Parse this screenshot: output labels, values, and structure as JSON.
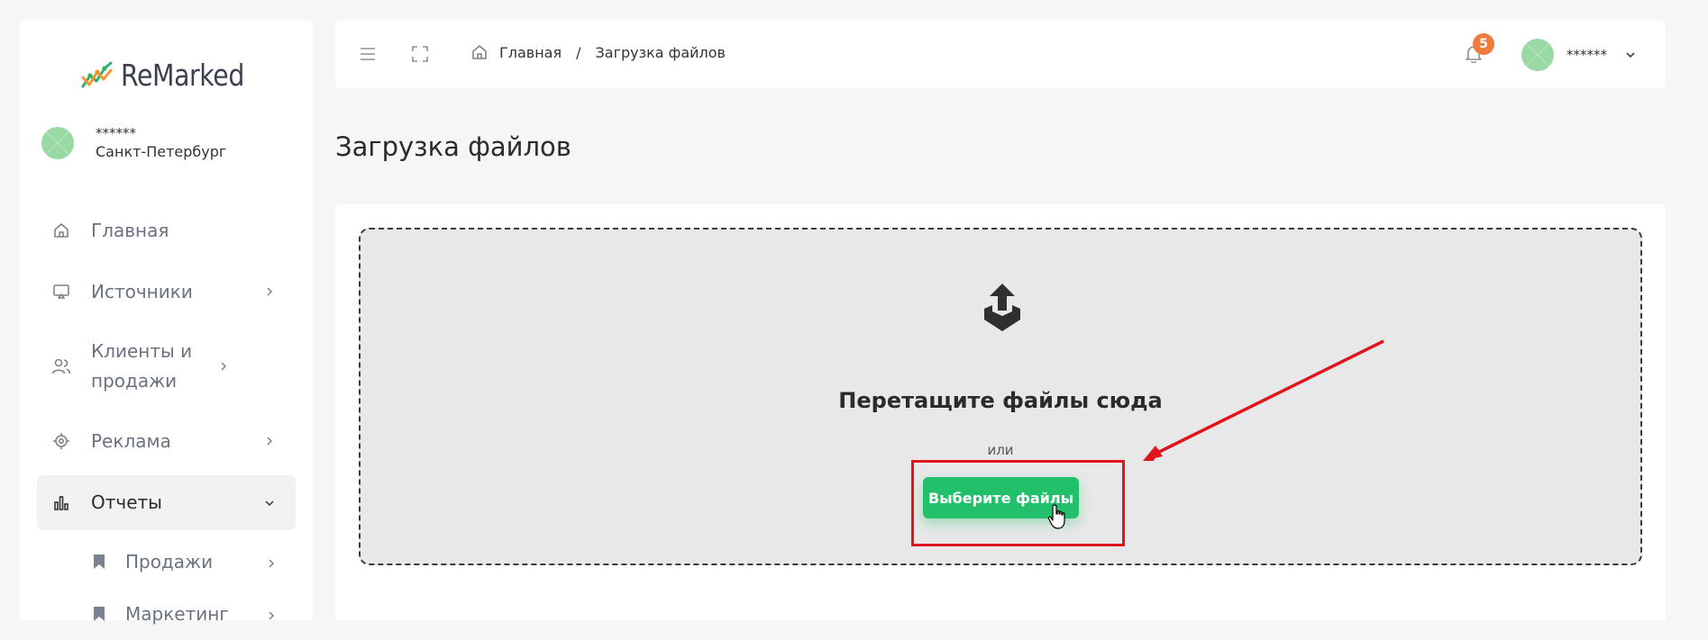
{
  "app": {
    "logo_text": "ReMarked"
  },
  "sidebar": {
    "user": {
      "name": "******",
      "city": "Санкт-Петербург"
    },
    "items": [
      {
        "label": "Главная",
        "icon": "home-icon",
        "has_chevron": false
      },
      {
        "label": "Источники",
        "icon": "monitor-icon",
        "has_chevron": true
      },
      {
        "label": "Клиенты и продажи",
        "icon": "users-icon",
        "has_chevron": true
      },
      {
        "label": "Реклама",
        "icon": "target-icon",
        "has_chevron": true
      },
      {
        "label": "Отчеты",
        "icon": "bar-chart-icon",
        "has_chevron": true,
        "active": true
      }
    ],
    "subitems": [
      {
        "label": "Продажи",
        "icon": "bookmark-icon"
      },
      {
        "label": "Маркетинг",
        "icon": "bookmark-icon"
      }
    ]
  },
  "topbar": {
    "breadcrumb": {
      "home": "Главная",
      "separator": "/",
      "current": "Загрузка файлов"
    },
    "notifications_count": "5",
    "user_name": "******"
  },
  "page": {
    "title": "Загрузка файлов",
    "dropzone": {
      "title": "Перетащите файлы сюда",
      "or": "или",
      "button": "Выберите файлы"
    }
  },
  "colors": {
    "accent_green": "#22c06a",
    "badge_orange": "#f07b3f",
    "annotation_red": "#e0141d"
  }
}
